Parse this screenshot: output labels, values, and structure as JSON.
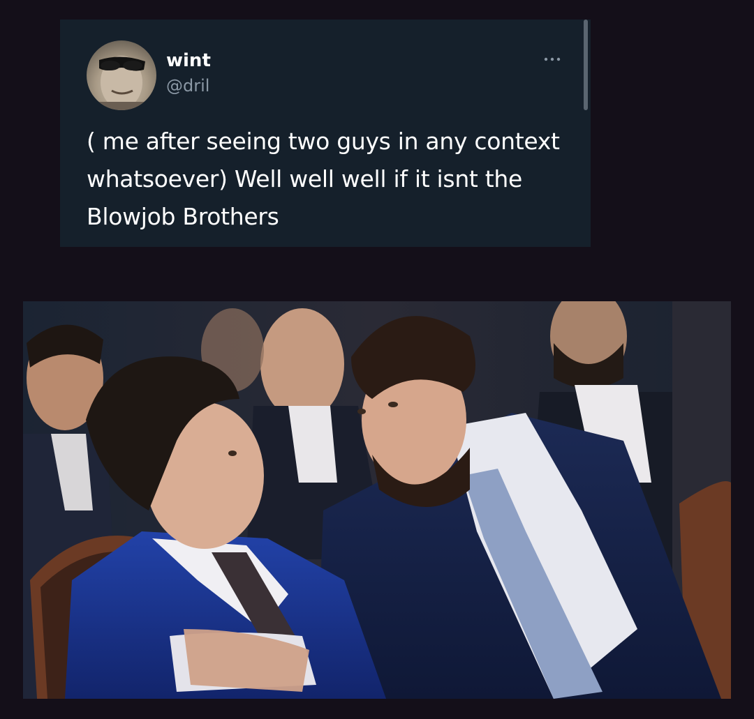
{
  "tweet": {
    "display_name": "wint",
    "handle": "@dril",
    "text": "( me after seeing two guys in any context whatsoever) Well well well if it isnt the Blowjob Brothers",
    "avatar_icon": "user-avatar-photo",
    "more_icon": "more-options-icon"
  },
  "photo": {
    "icon": "embedded-photo"
  },
  "colors": {
    "page_background": "#140f19",
    "card_background": "#15202b",
    "name": "#ffffff",
    "handle": "#8b98a5",
    "text": "#ffffff"
  }
}
